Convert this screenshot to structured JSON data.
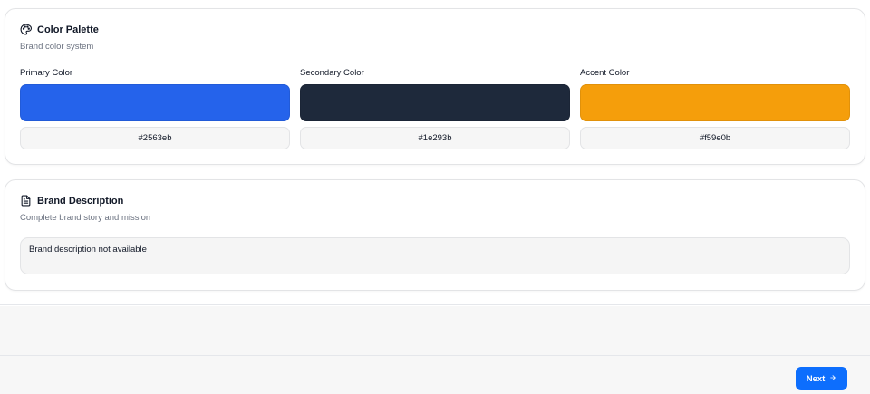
{
  "palette": {
    "title": "Color Palette",
    "subtitle": "Brand color system",
    "icon": "palette-icon",
    "colors": [
      {
        "label": "Primary Color",
        "hex": "#2563eb"
      },
      {
        "label": "Secondary Color",
        "hex": "#1e293b"
      },
      {
        "label": "Accent Color",
        "hex": "#f59e0b"
      }
    ]
  },
  "brand": {
    "title": "Brand Description",
    "subtitle": "Complete brand story and mission",
    "icon": "document-icon",
    "description": "Brand description not available"
  },
  "footer": {
    "next_label": "Next",
    "next_icon": "arrow-right-icon",
    "accent": "#0d6efd"
  }
}
